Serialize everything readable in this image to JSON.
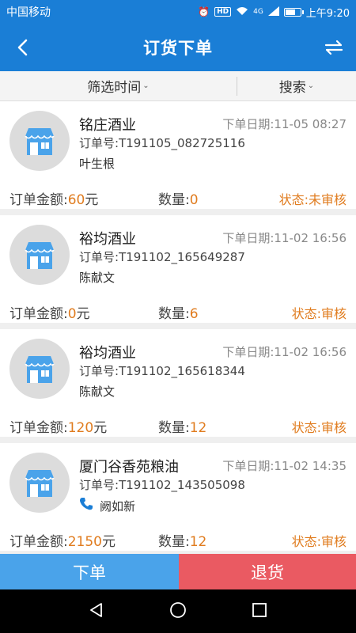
{
  "status_bar": {
    "carrier": "中国移动",
    "network": "4G",
    "time": "上午9:20",
    "battery_level": 0.7
  },
  "nav": {
    "title": "订货下单",
    "icons": {
      "back": "chevron-left-icon",
      "swap": "swap-arrows-icon"
    }
  },
  "filters": {
    "time_label": "筛选时间",
    "search_label": "搜索"
  },
  "labels": {
    "amount": "订单金额:",
    "qty": "数量:",
    "order_prefix": "订单号:",
    "date_prefix": "下单日期:",
    "currency": "元"
  },
  "orders": [
    {
      "name": "铭庄酒业",
      "date": "11-05 08:27",
      "order_no": "T191105_082725116",
      "contact": "叶生根",
      "has_phone": false,
      "amount": "60",
      "qty": "0",
      "status": "状态:未审核"
    },
    {
      "name": "裕均酒业",
      "date": "11-02 16:56",
      "order_no": "T191102_165649287",
      "contact": "陈献文",
      "has_phone": false,
      "amount": "0",
      "qty": "6",
      "status": "状态:审核"
    },
    {
      "name": "裕均酒业",
      "date": "11-02 16:56",
      "order_no": "T191102_165618344",
      "contact": "陈献文",
      "has_phone": false,
      "amount": "120",
      "qty": "12",
      "status": "状态:审核"
    },
    {
      "name": "厦门谷香苑粮油",
      "date": "11-02 14:35",
      "order_no": "T191102_143505098",
      "contact": "阙如新",
      "has_phone": true,
      "amount": "2150",
      "qty": "12",
      "status": "状态:审核"
    }
  ],
  "actions": {
    "order_label": "下单",
    "return_label": "退货"
  },
  "colors": {
    "primary": "#1a7ed6",
    "accent_orange": "#e07c1f",
    "order_btn": "#4aa3ea",
    "return_btn": "#ea5a62"
  }
}
